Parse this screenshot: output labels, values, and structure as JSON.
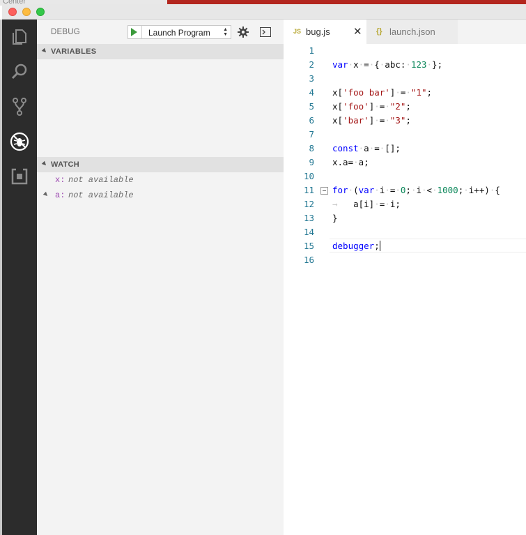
{
  "backdrop": {
    "ghost_text": "Center"
  },
  "debug": {
    "title": "DEBUG",
    "launch_config": "Launch Program"
  },
  "sections": {
    "variables": "VARIABLES",
    "watch": "WATCH"
  },
  "watch": [
    {
      "name": "x:",
      "value": "not available",
      "expandable": false
    },
    {
      "name": "a:",
      "value": "not available",
      "expandable": true
    }
  ],
  "tabs": [
    {
      "icon": "JS",
      "label": "bug.js",
      "active": true,
      "close": "✕"
    },
    {
      "icon": "{}",
      "label": "launch.json",
      "active": false
    }
  ],
  "line_numbers": [
    "1",
    "2",
    "3",
    "4",
    "5",
    "6",
    "7",
    "8",
    "9",
    "10",
    "11",
    "12",
    "13",
    "14",
    "15",
    "16"
  ],
  "code_lines": [
    "",
    "var x = { abc: 123 };",
    "",
    "x['foo bar'] = \"1\";",
    "x['foo'] = \"2\";",
    "x['bar'] = \"3\";",
    "",
    "const a = [];",
    "x.a= a;",
    "",
    "for (var i = 0; i < 1000; i++) {",
    "    a[i] = i;",
    "}",
    "",
    "debugger;",
    ""
  ],
  "cursor_line": 15,
  "colors": {
    "keyword": "#0000ff",
    "string": "#a31515",
    "number": "#098658",
    "line_number": "#237893",
    "activity_bar": "#2c2c2c",
    "sidebar": "#f3f3f3"
  },
  "icons": {
    "activity": [
      "explorer-icon",
      "search-icon",
      "source-control-icon",
      "debug-icon",
      "extensions-icon"
    ],
    "toolbar": [
      "play-icon",
      "gear-icon",
      "debug-console-icon"
    ]
  }
}
